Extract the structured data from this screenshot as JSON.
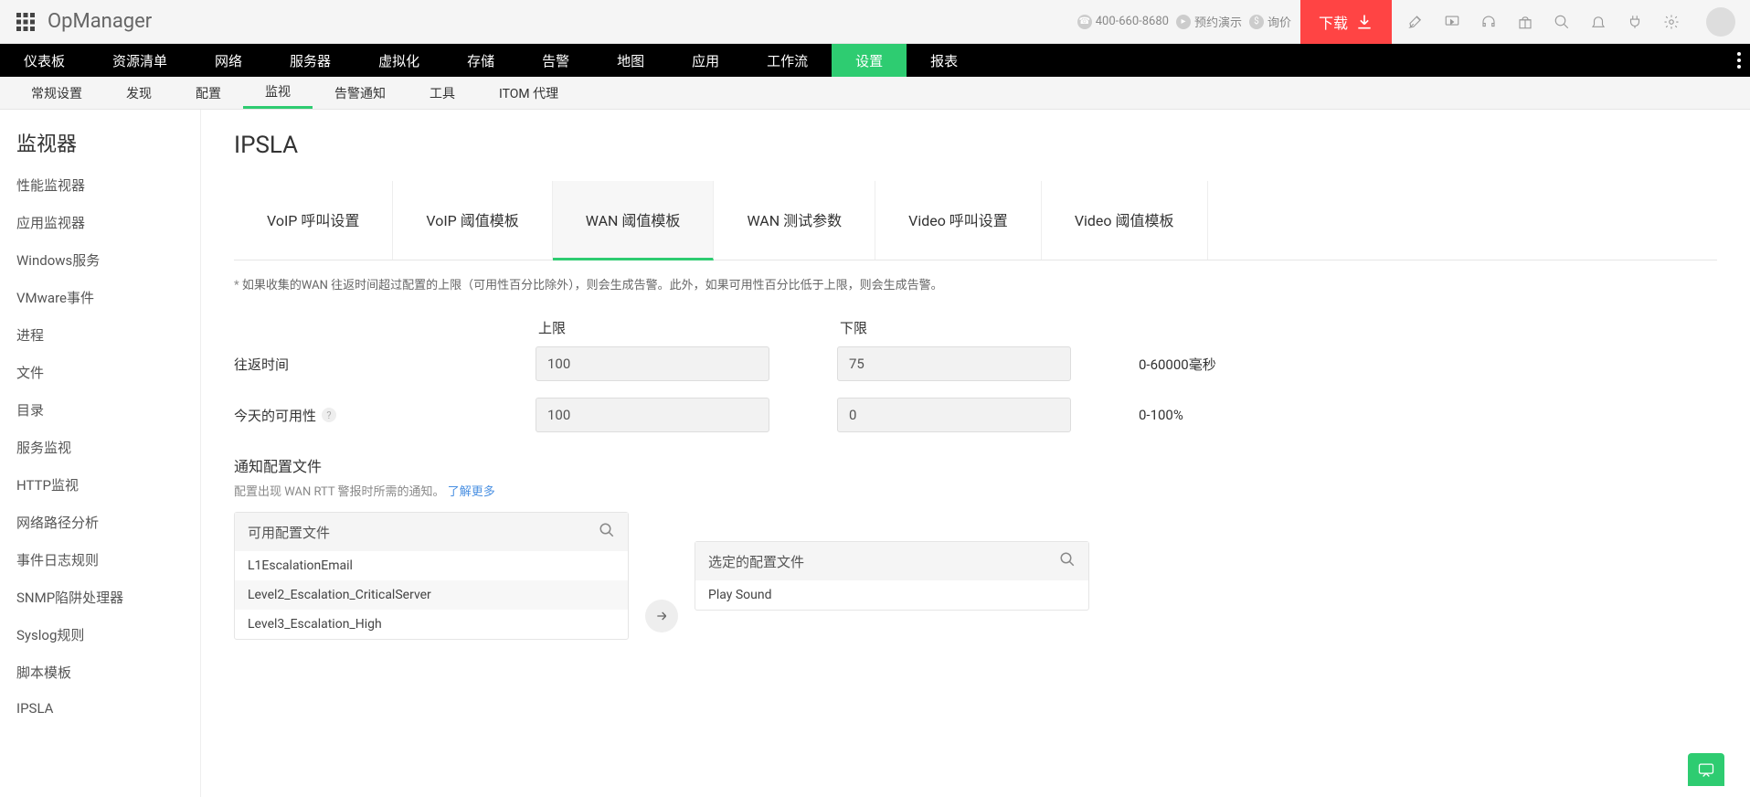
{
  "header": {
    "brand": "OpManager",
    "phone": "400-660-8680",
    "demo": "预约演示",
    "quote": "询价",
    "download": "下载"
  },
  "mainNav": [
    "仪表板",
    "资源清单",
    "网络",
    "服务器",
    "虚拟化",
    "存储",
    "告警",
    "地图",
    "应用",
    "工作流",
    "设置",
    "报表"
  ],
  "mainNavActiveIndex": 10,
  "subNav": [
    "常规设置",
    "发现",
    "配置",
    "监视",
    "告警通知",
    "工具",
    "ITOM 代理"
  ],
  "subNavActiveIndex": 3,
  "sidebar": {
    "title": "监视器",
    "items": [
      "性能监视器",
      "应用监视器",
      "Windows服务",
      "VMware事件",
      "进程",
      "文件",
      "目录",
      "服务监视",
      "HTTP监视",
      "网络路径分析",
      "事件日志规则",
      "SNMP陷阱处理器",
      "Syslog规则",
      "脚本模板",
      "IPSLA"
    ]
  },
  "page": {
    "title": "IPSLA",
    "tabs": [
      "VoIP 呼叫设置",
      "VoIP 阈值模板",
      "WAN 阈值模板",
      "WAN 测试参数",
      "Video 呼叫设置",
      "Video 阈值模板"
    ],
    "activeTabIndex": 2,
    "desc": "如果收集的WAN 往返时间超过配置的上限（可用性百分比除外），则会生成告警。此外，如果可用性百分比低于上限，则会生成告警。",
    "colUpper": "上限",
    "colLower": "下限",
    "rows": [
      {
        "label": "往返时间",
        "help": false,
        "upper": "100",
        "lower": "75",
        "range": "0-60000毫秒"
      },
      {
        "label": "今天的可用性",
        "help": true,
        "upper": "100",
        "lower": "0",
        "range": "0-100%"
      }
    ],
    "notif": {
      "title": "通知配置文件",
      "desc": "配置出现 WAN RTT 警报时所需的通知。",
      "learnMore": "了解更多",
      "availableLabel": "可用配置文件",
      "selectedLabel": "选定的配置文件",
      "available": [
        "L1EscalationEmail",
        "Level2_Escalation_CriticalServer",
        "Level3_Escalation_High"
      ],
      "selected": [
        "Play Sound"
      ]
    }
  }
}
